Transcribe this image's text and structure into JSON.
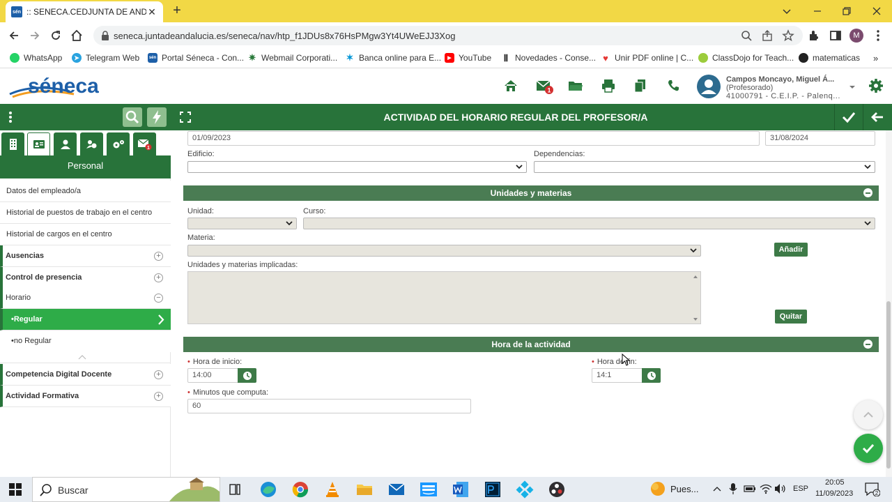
{
  "browser": {
    "tab_title": ":: SENECA.CEDJUNTA DE ANDALU",
    "favicon_text": "séneca",
    "url": "seneca.juntadeandalucia.es/seneca/nav/htp_f1JDUs8x76HsPMgw3Yt4UWeEJJ3Xog",
    "profile_initial": "M",
    "bookmarks": [
      {
        "label": "WhatsApp",
        "icon": "whatsapp-icon",
        "color": "#25d366"
      },
      {
        "label": "Telegram Web",
        "icon": "telegram-icon",
        "color": "#2aa3df"
      },
      {
        "label": "Portal Séneca - Con...",
        "icon": "seneca-icon",
        "color": "#1d5fa8"
      },
      {
        "label": "Webmail Corporati...",
        "icon": "webmail-icon",
        "color": "#2b7a3b"
      },
      {
        "label": "Banca online para E...",
        "icon": "bank-icon",
        "color": "#0096d6"
      },
      {
        "label": "YouTube",
        "icon": "youtube-icon",
        "color": "#ff0000"
      },
      {
        "label": "Novedades - Conse...",
        "icon": "novedades-icon",
        "color": "#222222"
      },
      {
        "label": "Unir PDF online | C...",
        "icon": "pdf-icon",
        "color": "#e53935"
      },
      {
        "label": "ClassDojo for Teach...",
        "icon": "classdojo-icon",
        "color": "#9ccc3c"
      },
      {
        "label": "matematicas",
        "icon": "globe-icon",
        "color": "#222222"
      }
    ]
  },
  "header": {
    "logo_text": "séneca",
    "mail_badge": "1",
    "user_name": "Campos Moncayo, Miguel Á...",
    "user_role": "(Profesorado)",
    "user_center": "41000791 - C.E.I.P. - Palenq..."
  },
  "page": {
    "title": "ACTIVIDAD DEL HORARIO REGULAR DEL PROFESOR/A"
  },
  "sidebar": {
    "section": "Personal",
    "tab_badge": "1",
    "items": [
      {
        "label": "Datos del empleado/a"
      },
      {
        "label": "Historial de puestos de trabajo en el centro"
      },
      {
        "label": "Historial de cargos en el centro"
      },
      {
        "label": "Ausencias"
      },
      {
        "label": "Control de presencia"
      },
      {
        "label": "Horario"
      },
      {
        "label": "•Regular"
      },
      {
        "label": "•no Regular"
      },
      {
        "label": "Competencia Digital Docente"
      },
      {
        "label": "Actividad Formativa"
      }
    ]
  },
  "form": {
    "fecha_inicio": "01/09/2023",
    "fecha_fin": "31/08/2024",
    "edificio_label": "Edificio:",
    "dependencias_label": "Dependencias:",
    "unidades_section": "Unidades y materias",
    "unidad_label": "Unidad:",
    "curso_label": "Curso:",
    "materia_label": "Materia:",
    "anadir_label": "Añadir",
    "implicadas_label": "Unidades y materias implicadas:",
    "quitar_label": "Quitar",
    "hora_section": "Hora de la actividad",
    "hora_inicio_label": "Hora de inicio:",
    "hora_inicio_value": "14:00",
    "hora_fin_label": "Hora de fin:",
    "hora_fin_value": "14:1",
    "minutos_label": "Minutos que computa:",
    "minutos_value": "60"
  },
  "taskbar": {
    "search_placeholder": "Buscar",
    "weather_text": "Pues...",
    "language": "ESP",
    "time": "20:05",
    "date": "11/09/2023",
    "notif_count": "2"
  }
}
